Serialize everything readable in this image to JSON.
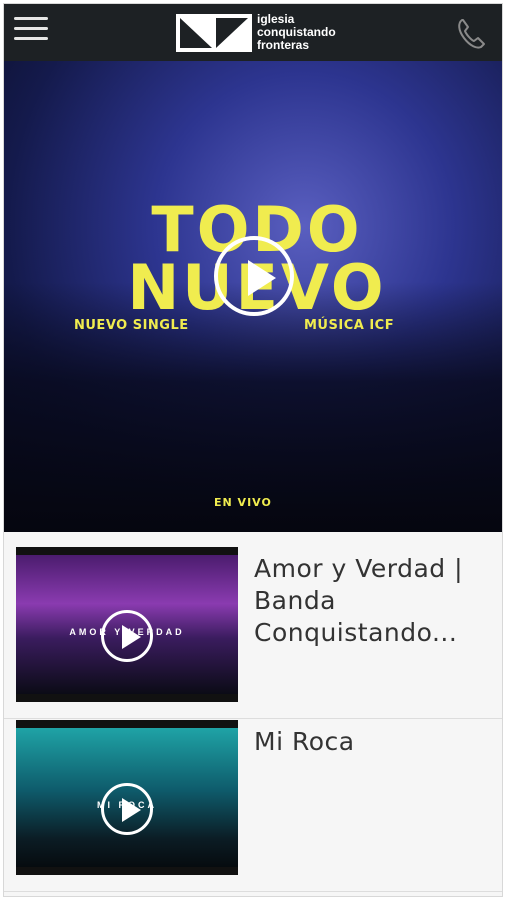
{
  "header": {
    "logo_text_line1": "iglesia",
    "logo_text_line2": "conquistando",
    "logo_text_line3": "fronteras",
    "menu_icon": "hamburger-menu-icon",
    "phone_icon": "phone-icon"
  },
  "hero": {
    "title_line1": "TODO",
    "title_line2": "NUEVO",
    "subtitle_left": "NUEVO SINGLE",
    "subtitle_right": "MÚSICA ICF",
    "footer": "EN VIVO",
    "accent_color": "#f0ec4f"
  },
  "videos": [
    {
      "title": "Amor y Verdad | Banda Conquistando...",
      "thumb_caption": "AMOR Y VERDAD"
    },
    {
      "title": "Mi Roca",
      "thumb_caption": "MI ROCA"
    }
  ]
}
